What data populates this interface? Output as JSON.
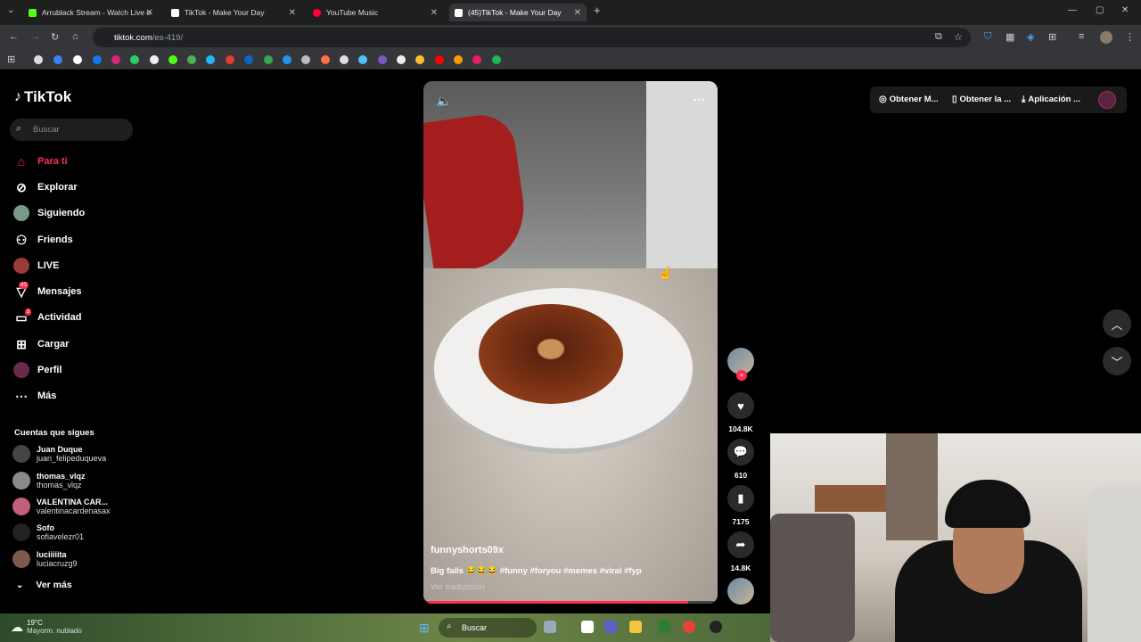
{
  "browser": {
    "tabs": [
      {
        "title": "Arrublack Stream - Watch Live o",
        "color": "#53fc18"
      },
      {
        "title": "TikTok - Make Your Day",
        "color": "#ffffff"
      },
      {
        "title": "YouTube Music",
        "color": "#ff0033"
      },
      {
        "title": "(45)TikTok - Make Your Day",
        "color": "#ffffff"
      }
    ],
    "new_tab": "+",
    "url_host": "tiktok.com",
    "url_path": "/es-419/"
  },
  "tiktok": {
    "logo": "TikTok",
    "search_placeholder": "Buscar",
    "nav": [
      {
        "label": "Para ti",
        "icon": "home-icon"
      },
      {
        "label": "Explorar",
        "icon": "compass-icon"
      },
      {
        "label": "Siguiendo",
        "icon": "following-avatar-icon"
      },
      {
        "label": "Friends",
        "icon": "friends-icon"
      },
      {
        "label": "LIVE",
        "icon": "live-icon"
      },
      {
        "label": "Mensajes",
        "icon": "messages-icon",
        "badge": "43"
      },
      {
        "label": "Actividad",
        "icon": "activity-icon",
        "badge": "2"
      },
      {
        "label": "Cargar",
        "icon": "upload-icon"
      },
      {
        "label": "Perfil",
        "icon": "profile-icon"
      },
      {
        "label": "Más",
        "icon": "more-icon"
      }
    ],
    "following_title": "Cuentas que sigues",
    "following": [
      {
        "name": "Juan Duque",
        "handle": "juan_felipeduqueva"
      },
      {
        "name": "thomas_vlqz",
        "handle": "thomas_vlqz"
      },
      {
        "name": "VALENTINA CAR...",
        "handle": "valentinacardenasax"
      },
      {
        "name": "Sofo",
        "handle": "sofiavelezr01"
      },
      {
        "name": "luciiiiita",
        "handle": "luciacruzg9"
      }
    ],
    "see_more": "Ver más",
    "video": {
      "username": "funnyshorts09x",
      "description": "Big fails 😂😂😂 #funny #foryou #memes #viral #fyp",
      "translate": "Ver traducción",
      "progress": 0.9
    },
    "actions": {
      "likes": "104.8K",
      "comments": "610",
      "saves": "7175",
      "shares": "14.8K"
    },
    "top_right": {
      "coins": "Obtener M...",
      "app": "Obtener la ...",
      "download": "Aplicación ..."
    }
  },
  "taskbar": {
    "temperature": "19°C",
    "weather": "Mayorm. nublado",
    "search": "Buscar"
  }
}
